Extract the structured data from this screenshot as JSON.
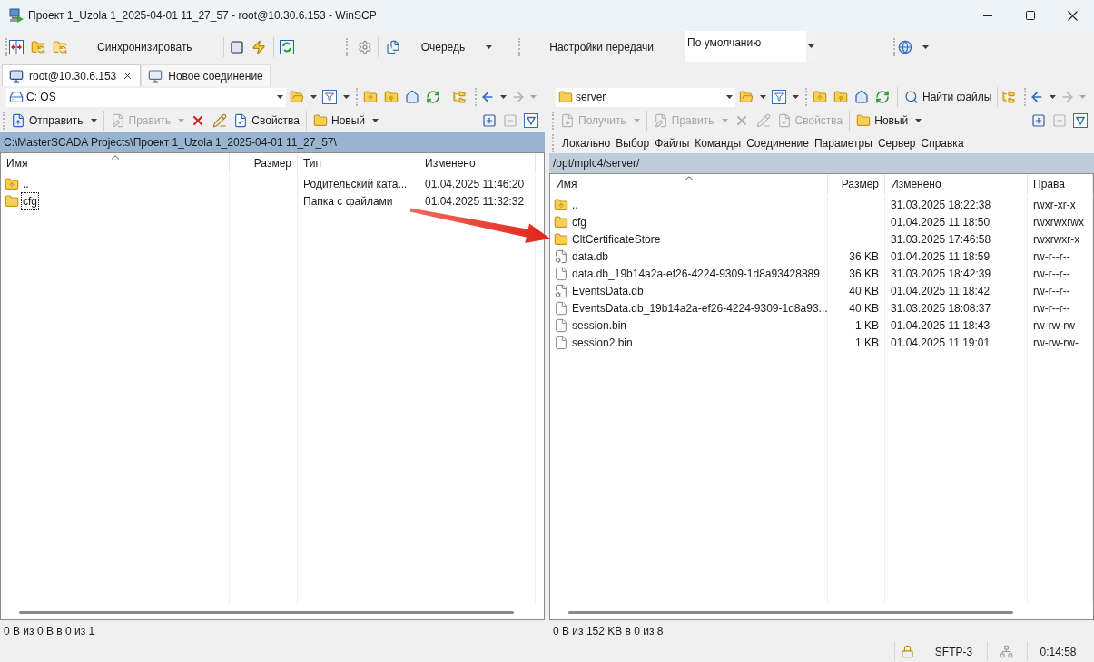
{
  "window": {
    "title": "Проект 1_Uzola 1_2025-04-01 11_27_57 - root@10.30.6.153 - WinSCP"
  },
  "toolbar": {
    "synchronize": "Синхронизировать",
    "queue": "Очередь",
    "transfer_settings": {
      "label": "Настройки передачи",
      "value": "По умолчанию"
    }
  },
  "tabs": [
    {
      "label": "root@10.30.6.153",
      "kind": "session",
      "selected": true
    },
    {
      "label": "Новое соединение",
      "kind": "new",
      "selected": false
    }
  ],
  "panels": [
    {
      "kind": "local",
      "active": true,
      "location": "C: OS",
      "actions": [
        {
          "kind": "upload",
          "label": "Отправить",
          "disabled": false
        },
        {
          "kind": "edit",
          "label": "Править",
          "disabled": true
        },
        {
          "kind": "delete",
          "disabled": false
        },
        {
          "kind": "rename",
          "disabled": false
        },
        {
          "kind": "properties",
          "label": "Свойства",
          "disabled": false
        },
        {
          "kind": "new",
          "label": "Новый",
          "disabled": false
        }
      ],
      "path": "C:\\MasterSCADA Projects\\Проект 1_Uzola 1_2025-04-01 11_27_57\\",
      "columns": [
        {
          "label": "Имя",
          "sorted": true
        },
        {
          "label": "Размер",
          "sorted": false
        },
        {
          "label": "Тип",
          "sorted": false
        },
        {
          "label": "Изменено",
          "sorted": false
        }
      ],
      "rows": [
        {
          "kind": "parent",
          "name": "..",
          "type": "Родительский ката...",
          "modified": "01.04.2025 11:46:20",
          "focused": false
        },
        {
          "kind": "folder",
          "name": "cfg",
          "type": "Папка с файлами",
          "modified": "01.04.2025 11:32:32",
          "focused": true
        }
      ],
      "status": "0 B из 0 B в 0 из 1"
    },
    {
      "kind": "remote",
      "active": false,
      "location": "server",
      "find_files": "Найти файлы",
      "actions": [
        {
          "kind": "download",
          "label": "Получить",
          "disabled": true
        },
        {
          "kind": "edit",
          "label": "Править",
          "disabled": true
        },
        {
          "kind": "delete",
          "disabled": true
        },
        {
          "kind": "rename",
          "disabled": true
        },
        {
          "kind": "properties",
          "label": "Свойства",
          "disabled": true
        },
        {
          "kind": "new",
          "label": "Новый",
          "disabled": false
        }
      ],
      "menu": [
        "Локально",
        "Выбор",
        "Файлы",
        "Команды",
        "Соединение",
        "Параметры",
        "Сервер",
        "Справка"
      ],
      "path": "/opt/mplc4/server/",
      "columns": [
        {
          "label": "Имя",
          "sorted": true
        },
        {
          "label": "Размер",
          "sorted": false
        },
        {
          "label": "Изменено",
          "sorted": false
        },
        {
          "label": "Права",
          "sorted": false
        }
      ],
      "rows": [
        {
          "kind": "parent",
          "name": "..",
          "modified": "31.03.2025 18:22:38",
          "rights": "rwxr-xr-x",
          "focused": false
        },
        {
          "kind": "folder",
          "name": "cfg",
          "modified": "01.04.2025 11:18:50",
          "rights": "rwxrwxrwx",
          "focused": false
        },
        {
          "kind": "folder",
          "name": "CltCertificateStore",
          "modified": "31.03.2025 17:46:58",
          "rights": "rwxrwxr-x",
          "focused": false
        },
        {
          "kind": "data",
          "name": "data.db",
          "size": "36 KB",
          "modified": "01.04.2025 11:18:59",
          "rights": "rw-r--r--",
          "focused": false
        },
        {
          "kind": "file",
          "name": "data.db_19b14a2a-ef26-4224-9309-1d8a93428889",
          "size": "36 KB",
          "modified": "31.03.2025 18:42:39",
          "rights": "rw-r--r--",
          "focused": false
        },
        {
          "kind": "data",
          "name": "EventsData.db",
          "size": "40 KB",
          "modified": "01.04.2025 11:18:42",
          "rights": "rw-r--r--",
          "focused": false
        },
        {
          "kind": "file",
          "name": "EventsData.db_19b14a2a-ef26-4224-9309-1d8a93...",
          "size": "40 KB",
          "modified": "31.03.2025 18:08:37",
          "rights": "rw-r--r--",
          "focused": false
        },
        {
          "kind": "file",
          "name": "session.bin",
          "size": "1 KB",
          "modified": "01.04.2025 11:18:43",
          "rights": "rw-rw-rw-",
          "focused": false
        },
        {
          "kind": "file",
          "name": "session2.bin",
          "size": "1 KB",
          "modified": "01.04.2025 11:19:01",
          "rights": "rw-rw-rw-",
          "focused": false
        }
      ],
      "status": "0 B из 152 KB в 0 из 8"
    }
  ],
  "status_bar": {
    "protocol": "SFTP-3",
    "elapsed": "0:14:58"
  }
}
